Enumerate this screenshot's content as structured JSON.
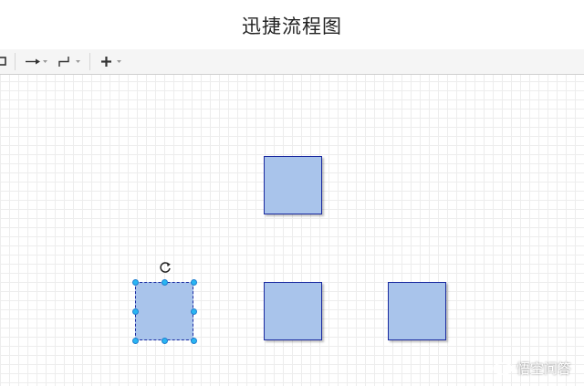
{
  "app": {
    "title": "迅捷流程图"
  },
  "toolbar": {
    "items": [
      {
        "name": "shape-tool-icon"
      },
      {
        "name": "connection-arrow-icon"
      },
      {
        "name": "waypoint-elbow-icon"
      },
      {
        "name": "insert-plus-icon"
      }
    ]
  },
  "canvas": {
    "shape_fill": "#a9c4eb",
    "shape_stroke": "#1a2aa0",
    "handle_color": "#29b6f2",
    "selected_shape": "shape-bottom-left"
  },
  "watermark": {
    "text": "悟空问答"
  }
}
